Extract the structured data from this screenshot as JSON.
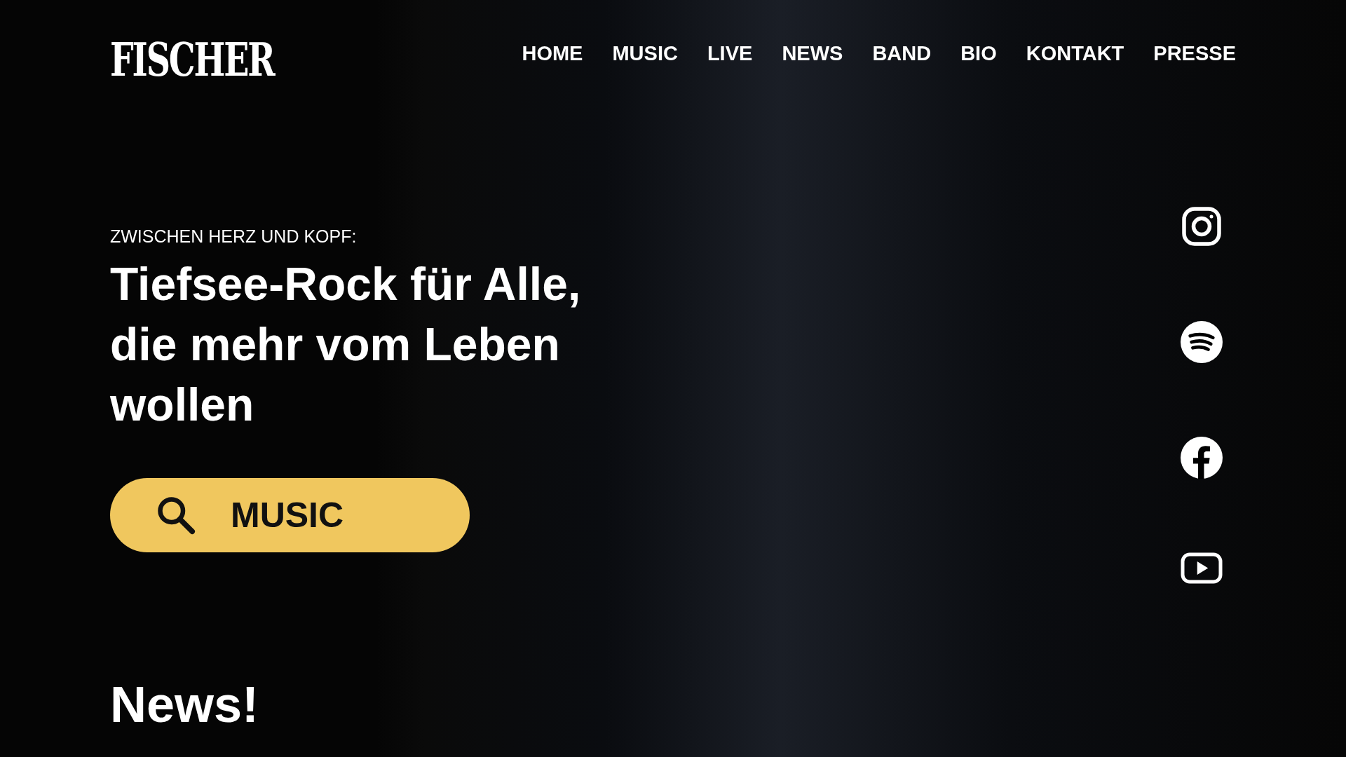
{
  "logo": "FISCHER",
  "nav": [
    {
      "label": "HOME"
    },
    {
      "label": "MUSIC"
    },
    {
      "label": "LIVE"
    },
    {
      "label": "NEWS"
    },
    {
      "label": "BAND"
    },
    {
      "label": "BIO"
    },
    {
      "label": "KONTAKT"
    },
    {
      "label": "PRESSE"
    }
  ],
  "hero": {
    "kicker": "ZWISCHEN HERZ UND KOPF:",
    "headline_lines": [
      "Tiefsee-Rock für Alle,",
      "die mehr vom Leben",
      "wollen"
    ],
    "button": "MUSIC"
  },
  "social": [
    {
      "kind": "instagram"
    },
    {
      "kind": "spotify"
    },
    {
      "kind": "facebook"
    },
    {
      "kind": "youtube"
    }
  ],
  "news_heading": "News!"
}
